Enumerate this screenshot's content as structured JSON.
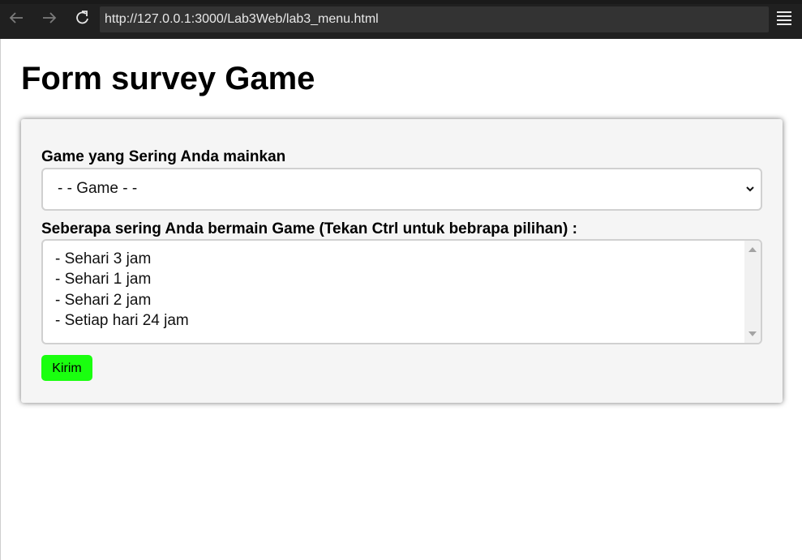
{
  "browser": {
    "url": "http://127.0.0.1:3000/Lab3Web/lab3_menu.html",
    "back_icon": "arrow-left",
    "forward_icon": "arrow-right",
    "reload_icon": "reload",
    "menu_icon": "hamburger-menu"
  },
  "page": {
    "title": "Form survey Game"
  },
  "form": {
    "game_label": "Game yang Sering Anda mainkan",
    "game_select_value": "- - Game - -",
    "frequency_label": "Seberapa sering Anda bermain Game (Tekan Ctrl untuk bebrapa pilihan) :",
    "frequency_options": [
      "- Sehari 3 jam",
      "- Sehari 1 jam",
      "- Sehari 2 jam",
      "- Setiap hari 24 jam"
    ],
    "submit_label": "Kirim"
  },
  "colors": {
    "browser_chrome": "#202020",
    "card_background": "#f5f5f5",
    "submit_button": "#1aff0f"
  }
}
